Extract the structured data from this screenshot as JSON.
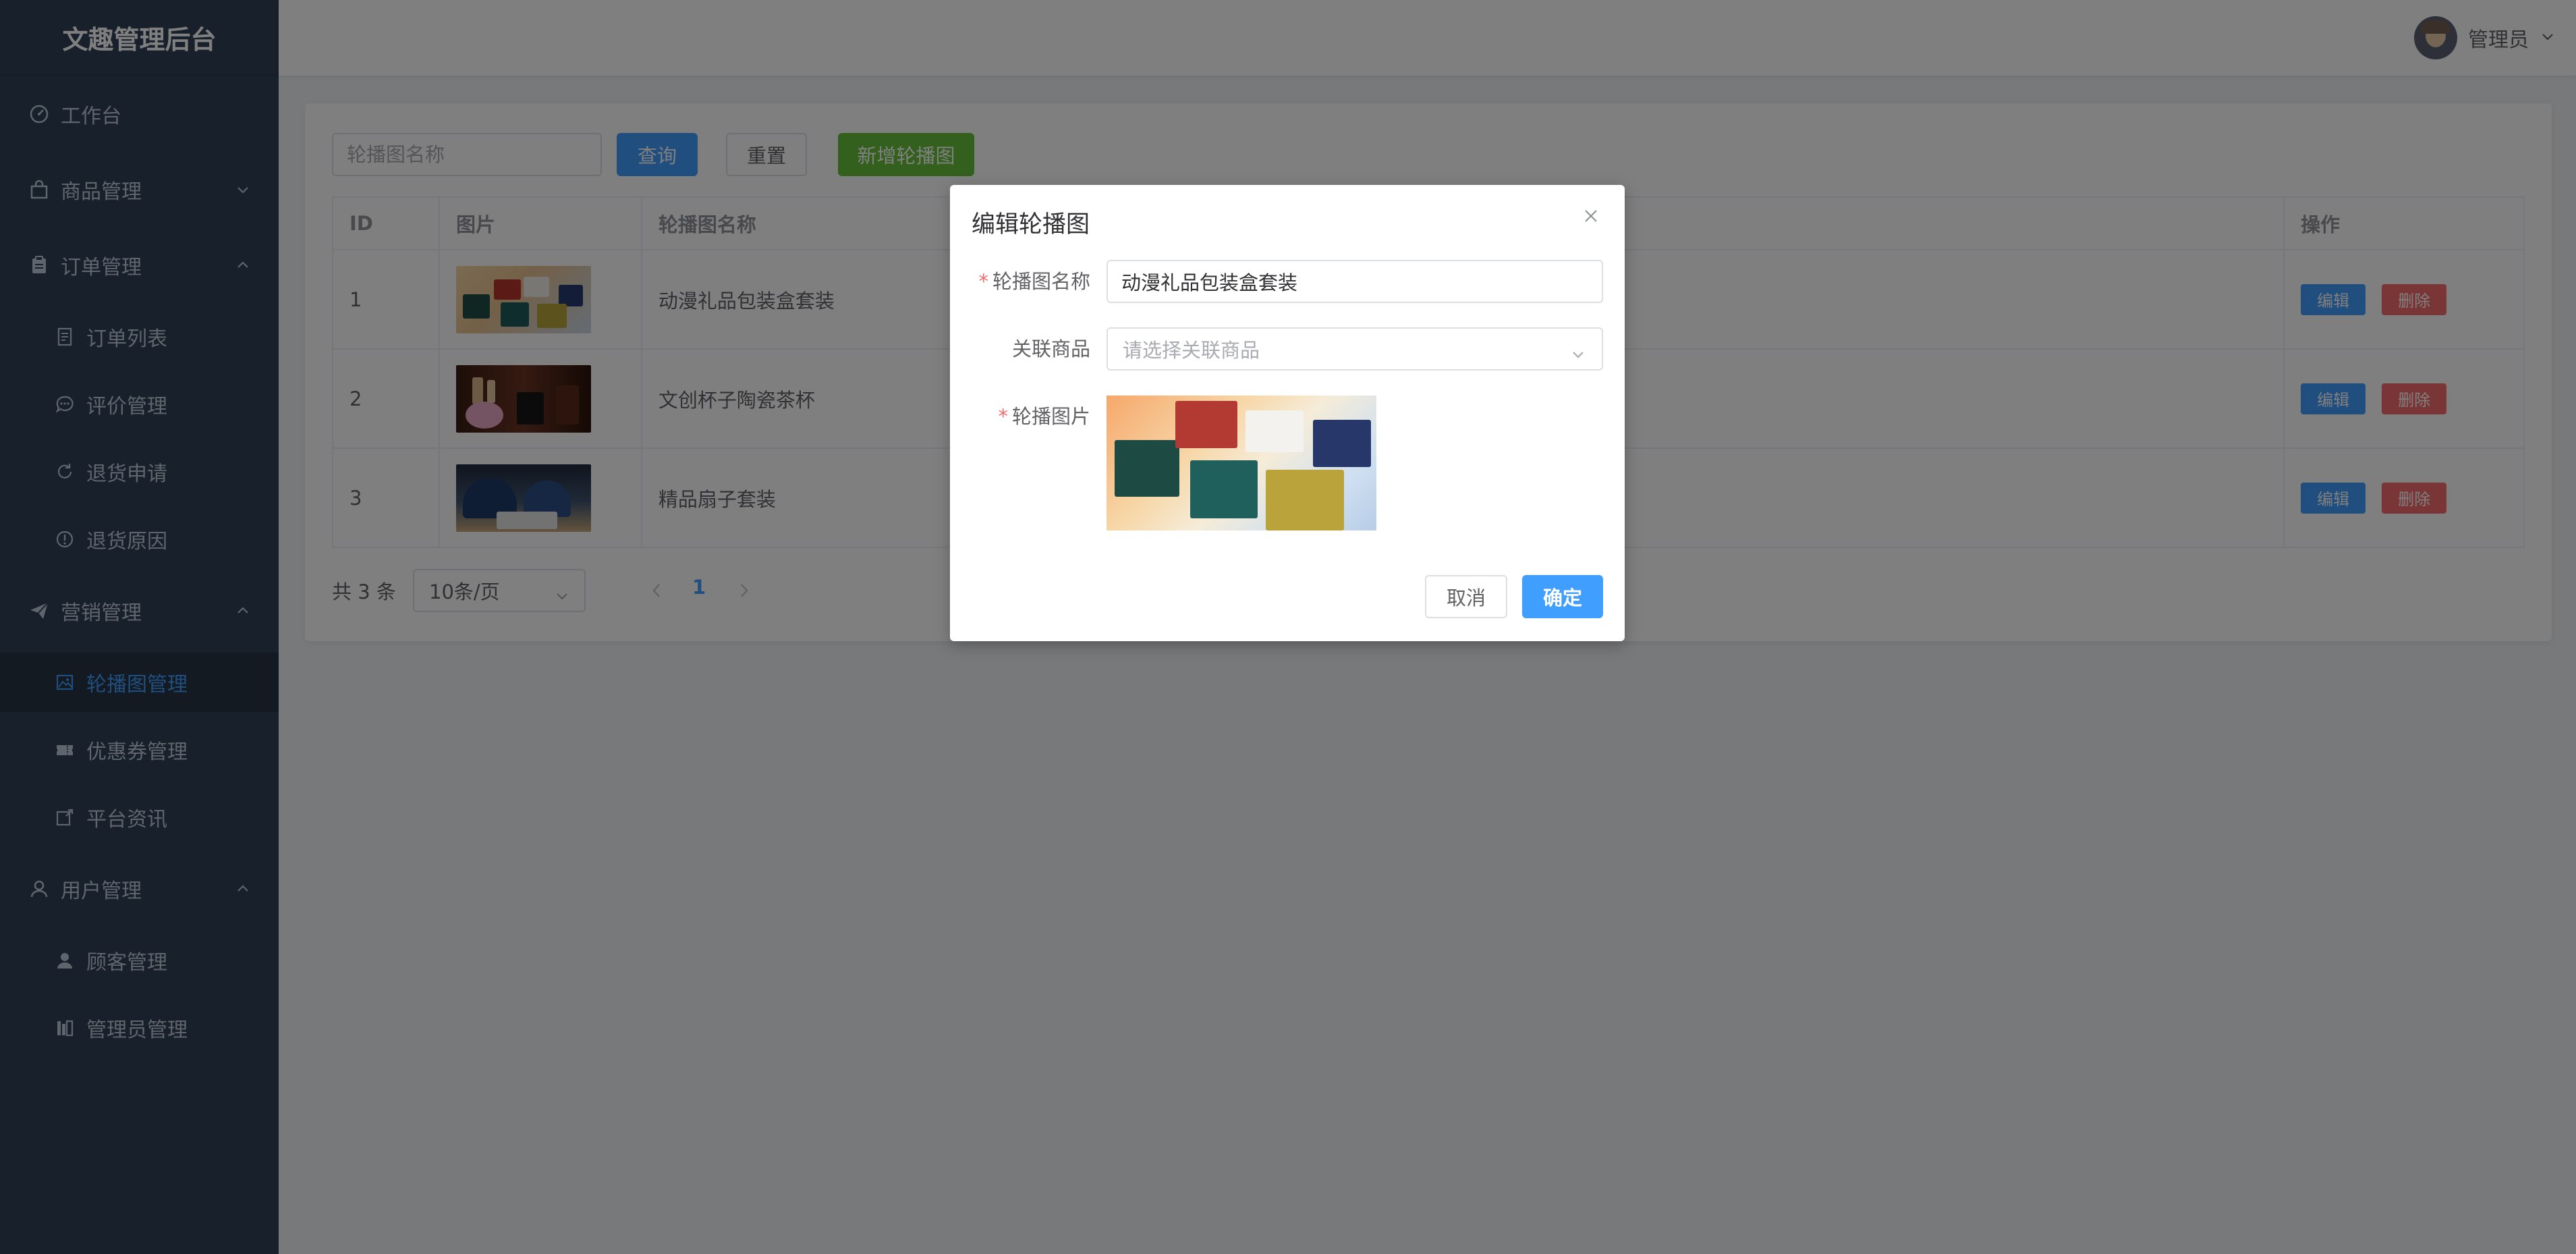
{
  "app": {
    "title": "文趣管理后台"
  },
  "header": {
    "username": "管理员"
  },
  "sidebar": {
    "items": [
      {
        "label": "工作台"
      },
      {
        "label": "商品管理"
      },
      {
        "label": "订单管理"
      },
      {
        "label": "订单列表"
      },
      {
        "label": "评价管理"
      },
      {
        "label": "退货申请"
      },
      {
        "label": "退货原因"
      },
      {
        "label": "营销管理"
      },
      {
        "label": "轮播图管理"
      },
      {
        "label": "优惠券管理"
      },
      {
        "label": "平台资讯"
      },
      {
        "label": "用户管理"
      },
      {
        "label": "顾客管理"
      },
      {
        "label": "管理员管理"
      }
    ]
  },
  "toolbar": {
    "search_placeholder": "轮播图名称",
    "query_label": "查询",
    "reset_label": "重置",
    "add_label": "新增轮播图"
  },
  "table": {
    "columns": [
      "ID",
      "图片",
      "轮播图名称",
      "操作"
    ],
    "rows": [
      {
        "id": "1",
        "name": "动漫礼品包装盒套装"
      },
      {
        "id": "2",
        "name": "文创杯子陶瓷茶杯"
      },
      {
        "id": "3",
        "name": "精品扇子套装"
      }
    ],
    "edit_label": "编辑",
    "delete_label": "删除"
  },
  "pagination": {
    "total": "共 3 条",
    "page_size": "10条/页",
    "current_page": "1"
  },
  "dialog": {
    "title": "编辑轮播图",
    "name_label": "轮播图名称",
    "name_value": "动漫礼品包装盒套装",
    "product_label": "关联商品",
    "product_placeholder": "请选择关联商品",
    "image_label": "轮播图片",
    "cancel_label": "取消",
    "ok_label": "确定"
  },
  "colors": {
    "sidebar_bg": "#304156",
    "primary": "#409eff",
    "success": "#67c23a",
    "danger": "#f56c6c"
  }
}
